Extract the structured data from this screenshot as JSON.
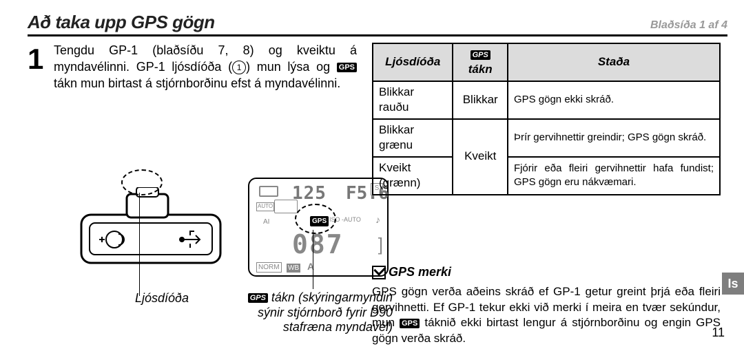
{
  "header": {
    "title": "Að taka upp GPS gögn",
    "page_info": "Blaðsíða 1 af 4"
  },
  "step": {
    "number": "1",
    "text_prefix": "Tengdu GP-1 (blaðsíðu 7, 8) og kveiktu á myndavélinni. GP-1 ljósdíóða (",
    "circled": "1",
    "text_mid": ") mun lýsa og ",
    "gps_badge": "GPS",
    "text_suffix": " tákn mun birtast á stjórnborðinu efst á myndavélinni."
  },
  "lcd": {
    "shutter": "125",
    "fstop": "F5.6",
    "s": "S",
    "auto": "AUTO",
    "mid": "AI",
    "gps": "GPS",
    "isoauto": "ISO -AUTO",
    "counter": "087",
    "norm": "NORM",
    "wb": "WB",
    "a": "A"
  },
  "captions": {
    "left": "Ljósdíóða",
    "right_line1_badge": "GPS",
    "right_line1": " tákn (skýringarmyndin sýnir stjórnborð fyrir D90 stafræna myndavél)"
  },
  "table": {
    "h1": "Ljósdíóða",
    "h2_badge": "GPS",
    "h2": " tákn",
    "h3": "Staða",
    "rows": [
      {
        "diode": "Blikkar rauðu",
        "icon": "Blikkar",
        "status": "GPS gögn ekki skráð."
      },
      {
        "diode": "Blikkar grænu",
        "icon": "Kveikt",
        "status": "Þrír gervihnettir greindir; GPS gögn skráð."
      },
      {
        "diode": "Kveikt (grænn)",
        "icon": "Kveikt",
        "status": "Fjórir eða fleiri gervihnettir hafa fundist; GPS gögn eru nákvæmari."
      }
    ]
  },
  "merki": {
    "heading": "GPS merki",
    "body_prefix": "GPS gögn verða aðeins skráð ef GP-1 getur greint þrjá eða fleiri gervihnetti. Ef GP-1 tekur ekki við merki í meira en tvær sekúndur, mun ",
    "body_badge": "GPS",
    "body_suffix": " táknið ekki birtast lengur á stjórnborðinu og engin GPS gögn verða skráð."
  },
  "side_tab": "Is",
  "page_number": "11"
}
